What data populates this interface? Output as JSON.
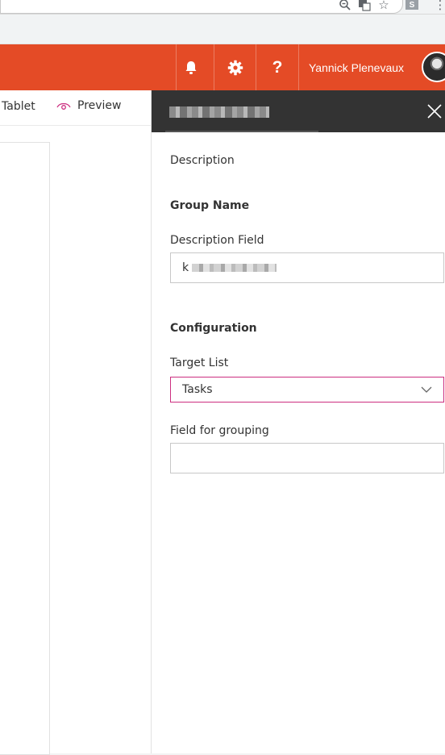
{
  "browser": {
    "icons": [
      "zoom-icon",
      "translate-icon",
      "bookmark-star-icon",
      "extension-icon",
      "menu-icon"
    ],
    "extension_label": "S"
  },
  "suite_bar": {
    "accent_color": "#e44b26",
    "icons": [
      "bell-icon",
      "gear-icon",
      "help-icon"
    ],
    "help_label": "?",
    "user_name": "Yannick Plenevaux"
  },
  "command_bar": {
    "tablet_label": "Tablet",
    "preview_label": "Preview"
  },
  "property_pane": {
    "header_color": "#333333",
    "description": "Description",
    "group_name": "Group Name",
    "description_field_label": "Description Field",
    "description_field_value_prefix": "k",
    "configuration_heading": "Configuration",
    "target_list_label": "Target List",
    "target_list_value": "Tasks",
    "target_list_border_color": "#cc2f80",
    "field_for_grouping_label": "Field for grouping",
    "field_for_grouping_value": ""
  }
}
